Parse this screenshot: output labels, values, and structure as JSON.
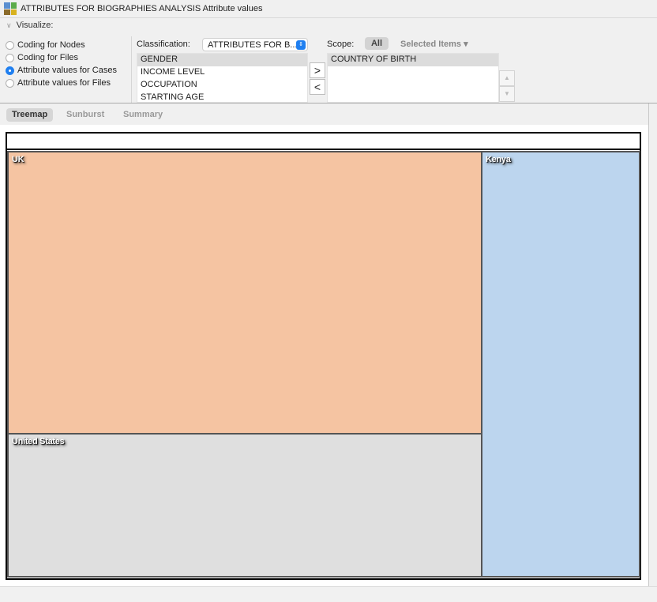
{
  "window": {
    "title": "ATTRIBUTES FOR BIOGRAPHIES ANALYSIS Attribute values"
  },
  "visualize": {
    "label": "Visualize:",
    "options": [
      {
        "label": "Coding for Nodes",
        "selected": false
      },
      {
        "label": "Coding for Files",
        "selected": false
      },
      {
        "label": "Attribute values for Cases",
        "selected": true
      },
      {
        "label": "Attribute values for Files",
        "selected": false
      }
    ]
  },
  "classification": {
    "label": "Classification:",
    "value": "ATTRIBUTES FOR B...",
    "attributes": [
      "GENDER",
      "INCOME LEVEL",
      "OCCUPATION",
      "STARTING AGE"
    ],
    "selected_attribute": "GENDER"
  },
  "move": {
    "add": ">",
    "remove": "<"
  },
  "scope": {
    "label": "Scope:",
    "all_label": "All",
    "selected_items_label": "Selected Items ▾",
    "chosen": [
      "COUNTRY OF BIRTH"
    ]
  },
  "tabs": [
    {
      "label": "Treemap",
      "active": true
    },
    {
      "label": "Sunburst",
      "active": false
    },
    {
      "label": "Summary",
      "active": false
    }
  ],
  "treemap": {
    "cells": [
      {
        "label": "UK",
        "color": "#f5c4a2"
      },
      {
        "label": "United States",
        "color": "#dfdfdf"
      },
      {
        "label": "Kenya",
        "color": "#bcd5ee"
      }
    ]
  }
}
